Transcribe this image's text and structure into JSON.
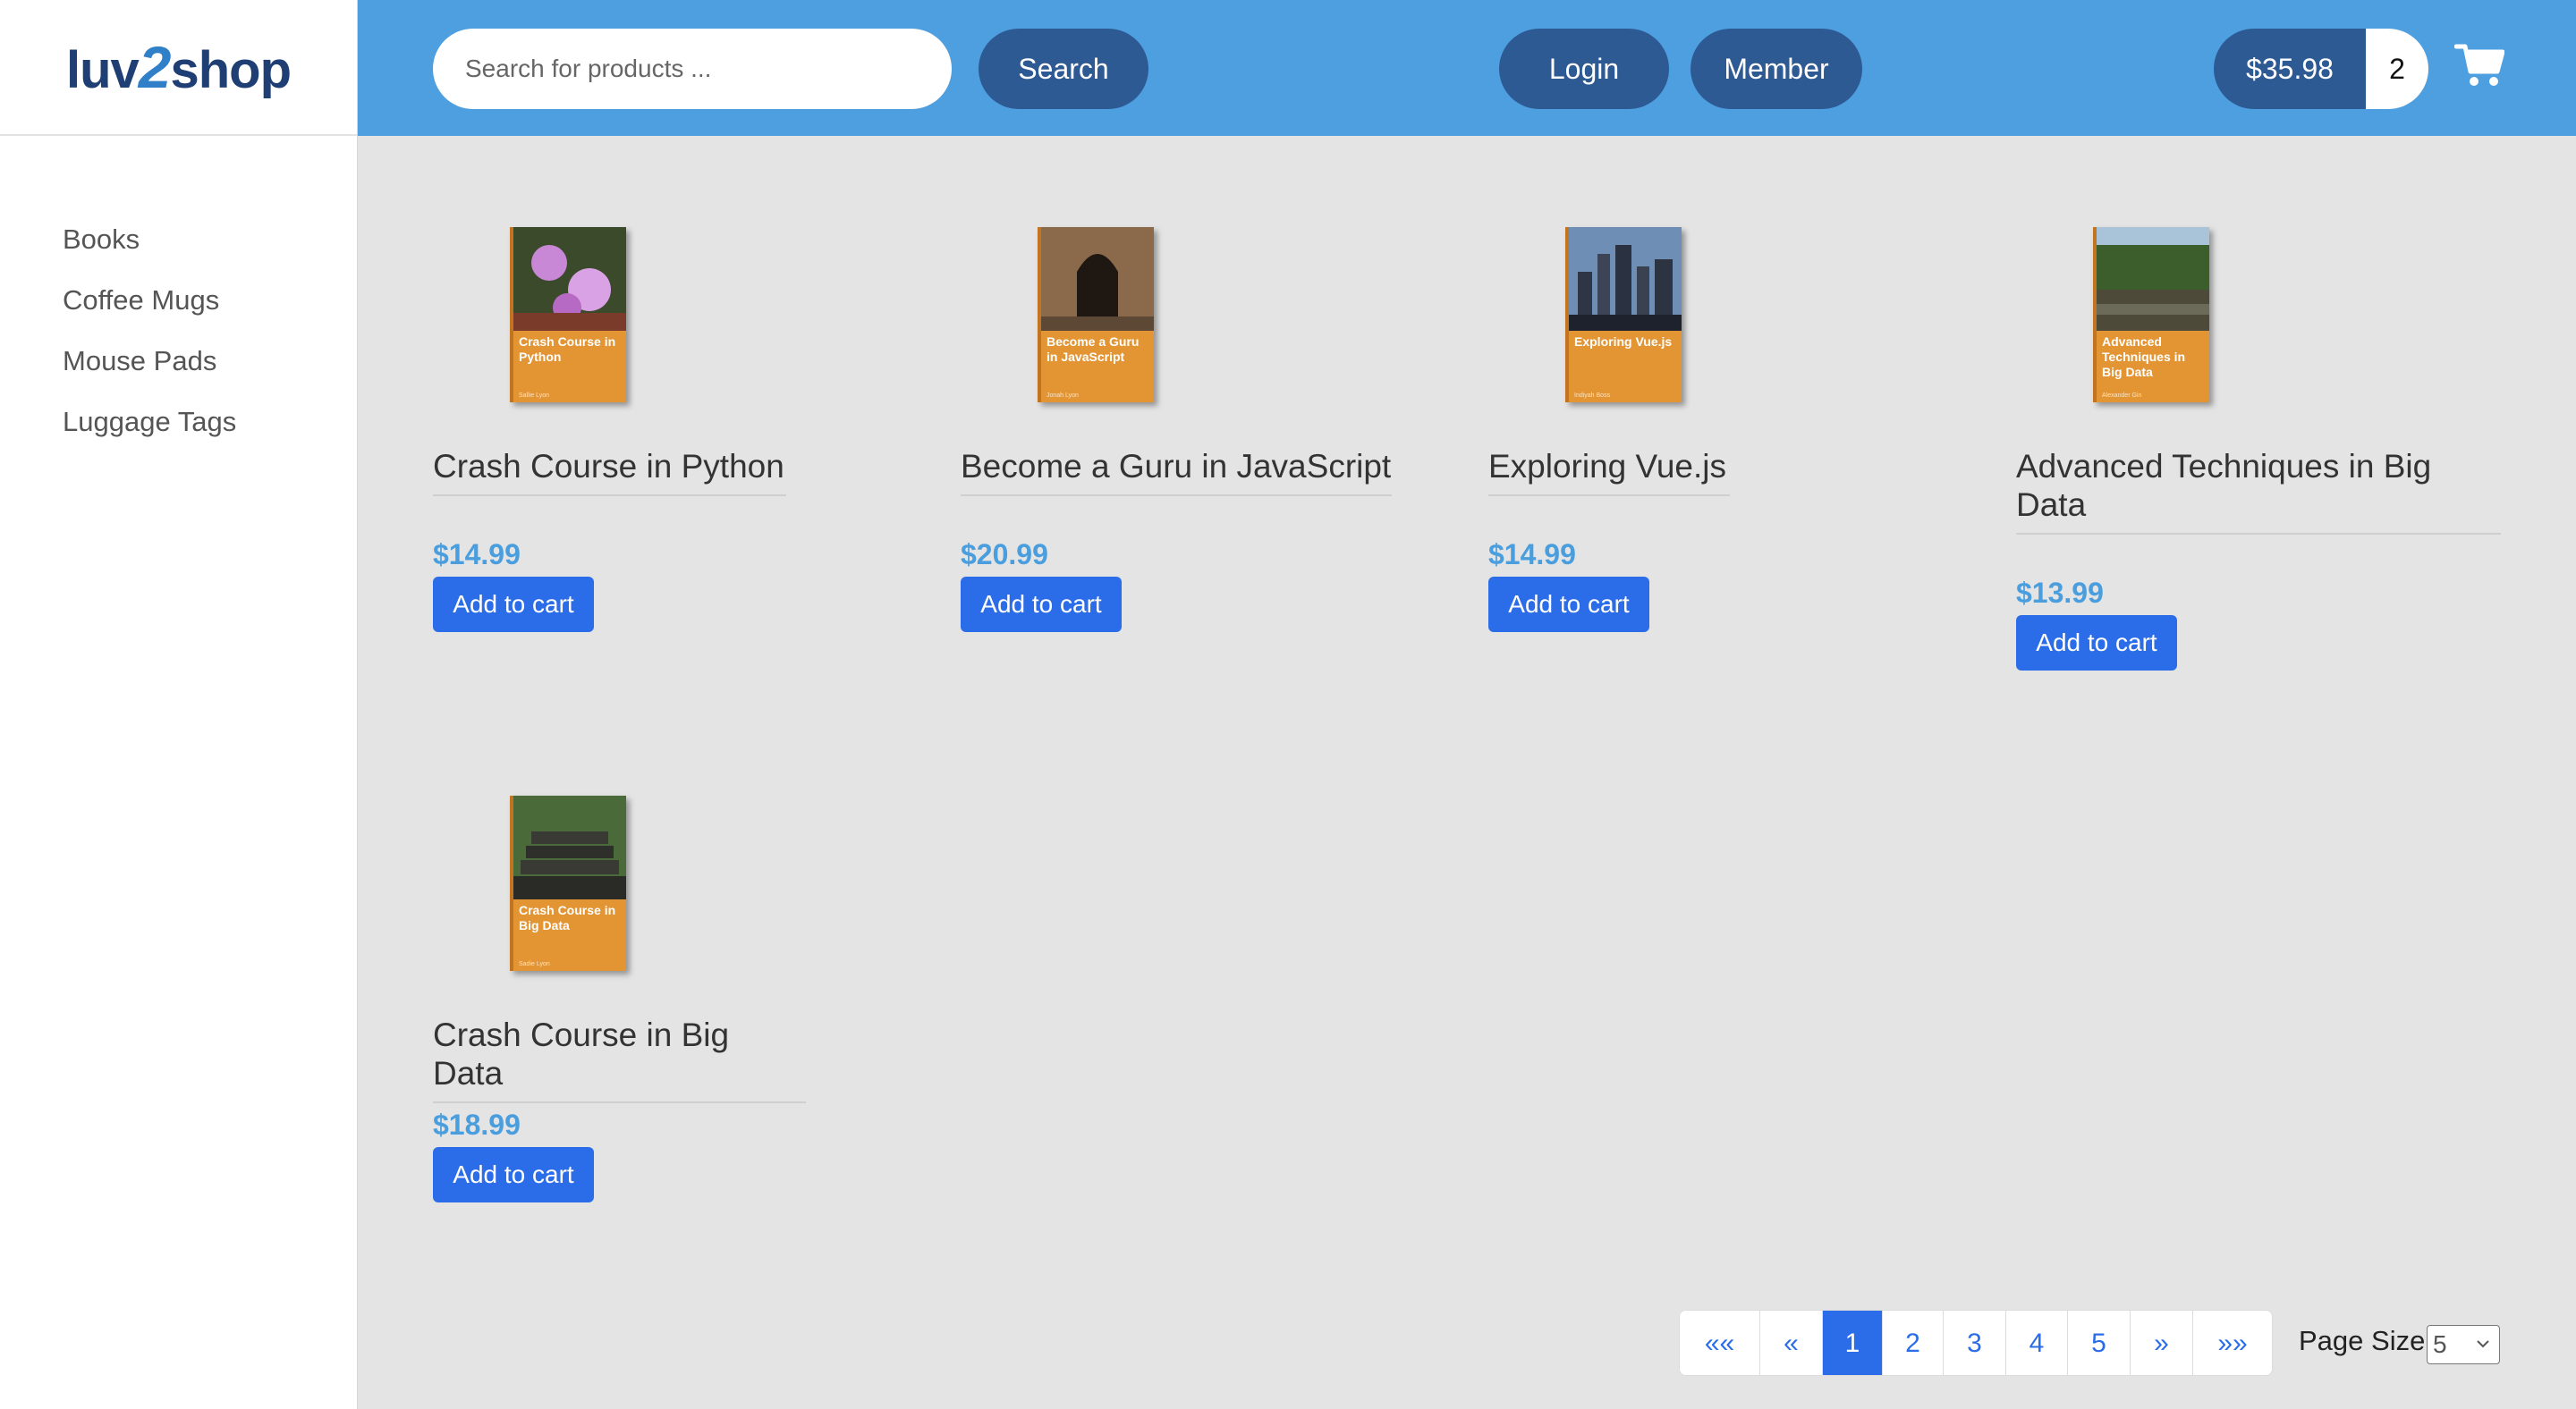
{
  "brand": {
    "logo_left": "luv",
    "logo_two": "2",
    "logo_right": "shop"
  },
  "sidebar": {
    "items": [
      {
        "label": "Books"
      },
      {
        "label": "Coffee Mugs"
      },
      {
        "label": "Mouse Pads"
      },
      {
        "label": "Luggage Tags"
      }
    ]
  },
  "header": {
    "search_placeholder": "Search for products ...",
    "search_label": "Search",
    "login_label": "Login",
    "member_label": "Member",
    "cart_total": "$35.98",
    "cart_quantity": "2",
    "cart_icon": "shopping-cart-icon"
  },
  "products": [
    {
      "name": "Crash Course in Python",
      "price": "$14.99",
      "button": "Add to cart",
      "cover_title": "Crash Course in Python",
      "cover_author": "Sallie Lyon"
    },
    {
      "name": "Become a Guru in JavaScript",
      "price": "$20.99",
      "button": "Add to cart",
      "cover_title": "Become a Guru in JavaScript",
      "cover_author": "Jonah Lyon"
    },
    {
      "name": "Exploring Vue.js",
      "price": "$14.99",
      "button": "Add to cart",
      "cover_title": "Exploring Vue.js",
      "cover_author": "Indiyah Boss"
    },
    {
      "name": "Advanced Techniques in Big Data",
      "price": "$13.99",
      "button": "Add to cart",
      "cover_title": "Advanced Techniques in Big Data",
      "cover_author": "Alexander Gin"
    },
    {
      "name": "Crash Course in Big Data",
      "price": "$18.99",
      "button": "Add to cart",
      "cover_title": "Crash Course in Big Data",
      "cover_author": "Sadie Lyon"
    }
  ],
  "pagination": {
    "first": "««",
    "prev": "«",
    "pages": [
      "1",
      "2",
      "3",
      "4",
      "5"
    ],
    "current_page": "1",
    "next": "»",
    "last": "»»",
    "page_size_label": "Page Size",
    "page_size_value": "5"
  },
  "colors": {
    "header_bg": "#4e9fe0",
    "pill_bg": "#2e5a94",
    "primary_button": "#2b6de8",
    "price_color": "#4a9ede",
    "page_bg": "#e4e4e4",
    "cover_orange": "#e39534"
  }
}
